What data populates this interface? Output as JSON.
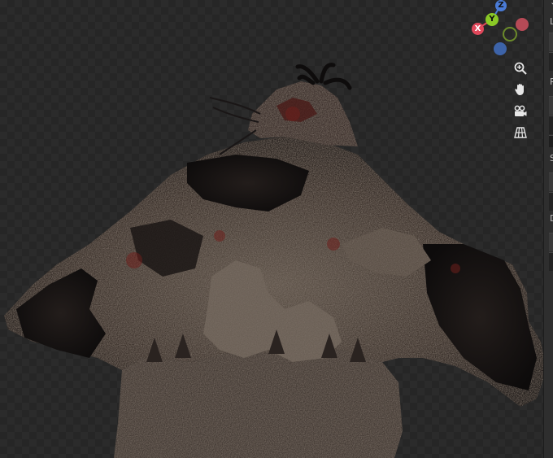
{
  "viewport": {
    "gizmo": {
      "axes": [
        {
          "id": "z",
          "label": "Z",
          "color": "#4a7bd6"
        },
        {
          "id": "y",
          "label": "Y",
          "color": "#8ac926"
        },
        {
          "id": "x",
          "label": "X",
          "color": "#e0485b"
        },
        {
          "id": "x-neg",
          "label": "",
          "color": "#b64a56"
        },
        {
          "id": "y-neg",
          "label": "",
          "color": "#6b8a2a"
        },
        {
          "id": "z-neg",
          "label": "",
          "color": "#3d63a8"
        }
      ]
    },
    "nav_buttons": [
      {
        "icon": "zoom-icon"
      },
      {
        "icon": "hand-pan-icon"
      },
      {
        "icon": "camera-view-icon"
      },
      {
        "icon": "perspective-grid-icon"
      }
    ]
  },
  "side_panel": {
    "letters": [
      "L",
      "R",
      "S",
      "D"
    ]
  }
}
